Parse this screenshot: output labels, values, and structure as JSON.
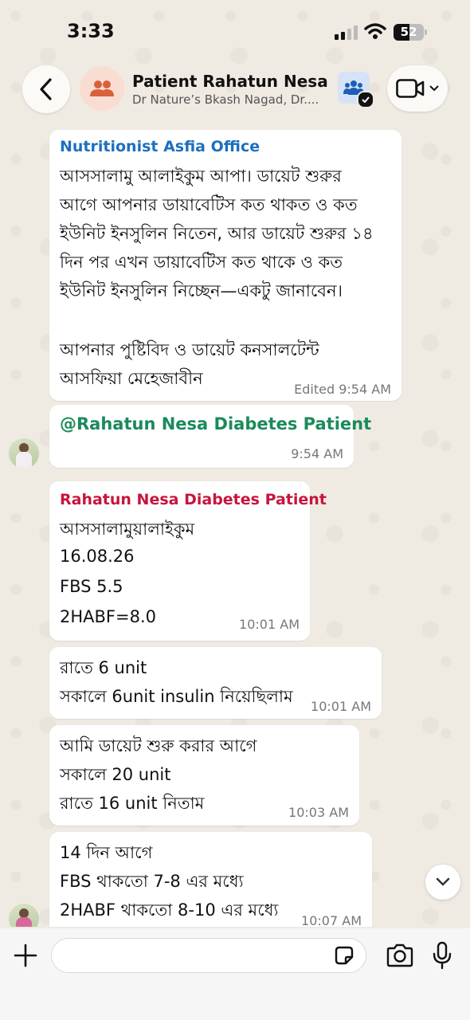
{
  "status_bar": {
    "time": "3:33",
    "battery": "52",
    "battery_level_percent": 52
  },
  "header": {
    "title": "Patient Rahatun Nesa",
    "subtitle": "Dr Nature’s Bkash Nagad, Dr...."
  },
  "messages": [
    {
      "sender": "Nutritionist Asfia Office",
      "sender_color": "#1d6fbf",
      "lines": [
        "আসসালামু আলাইকুম আপা। ডায়েট শুরুর",
        "আগে আপনার ডায়াবেটিস কত থাকত ও কত",
        "ইউনিট ইনসুলিন নিতেন, আর ডায়েট শুরুর ১৪",
        "দিন পর এখন ডায়াবেটিস কত থাকে ও কত",
        "ইউনিট ইনসুলিন নিচ্ছেন—একটু জানাবেন।",
        "",
        "আপনার পুষ্টিবিদ ও ডায়েট কনসালটেন্ট",
        "আসফিয়া মেহেজাবীন"
      ],
      "meta": "Edited 9:54 AM"
    },
    {
      "mention": "@Rahatun Nesa Diabetes Patient",
      "mention_color": "#1b8a5a",
      "meta": "9:54 AM"
    },
    {
      "sender": "Rahatun Nesa Diabetes Patient",
      "sender_color": "#c8143c",
      "lines": [
        "আসসালামুয়ালাইকুম",
        "16.08.26",
        "FBS 5.5",
        "2HABF=8.0"
      ],
      "meta": "10:01 AM"
    },
    {
      "lines": [
        "রাতে 6 unit",
        "সকালে 6unit insulin নিয়েছিলাম"
      ],
      "meta": "10:01 AM"
    },
    {
      "lines": [
        "আমি ডায়েট শুরু করার আগে",
        "সকালে 20 unit",
        "রাতে    16 unit নিতাম"
      ],
      "meta": "10:03 AM"
    },
    {
      "lines": [
        "14 দিন আগে",
        "FBS থাকতো 7-8 এর মধ্যে",
        "2HABF থাকতো 8-10 এর মধ্যে"
      ],
      "meta": "10:07 AM"
    }
  ],
  "input": {
    "placeholder": ""
  },
  "icons": {
    "back": "chevron-left-icon",
    "group": "people-icon",
    "community": "community-icon",
    "video": "video-camera-icon",
    "scroll": "chevron-down-icon",
    "plus": "plus-icon",
    "sticker": "sticker-icon",
    "camera": "camera-icon",
    "mic": "microphone-icon"
  },
  "colors": {
    "accent_orange": "#d9603b",
    "wallpaper": "#efeae2",
    "bubble": "#ffffff"
  }
}
